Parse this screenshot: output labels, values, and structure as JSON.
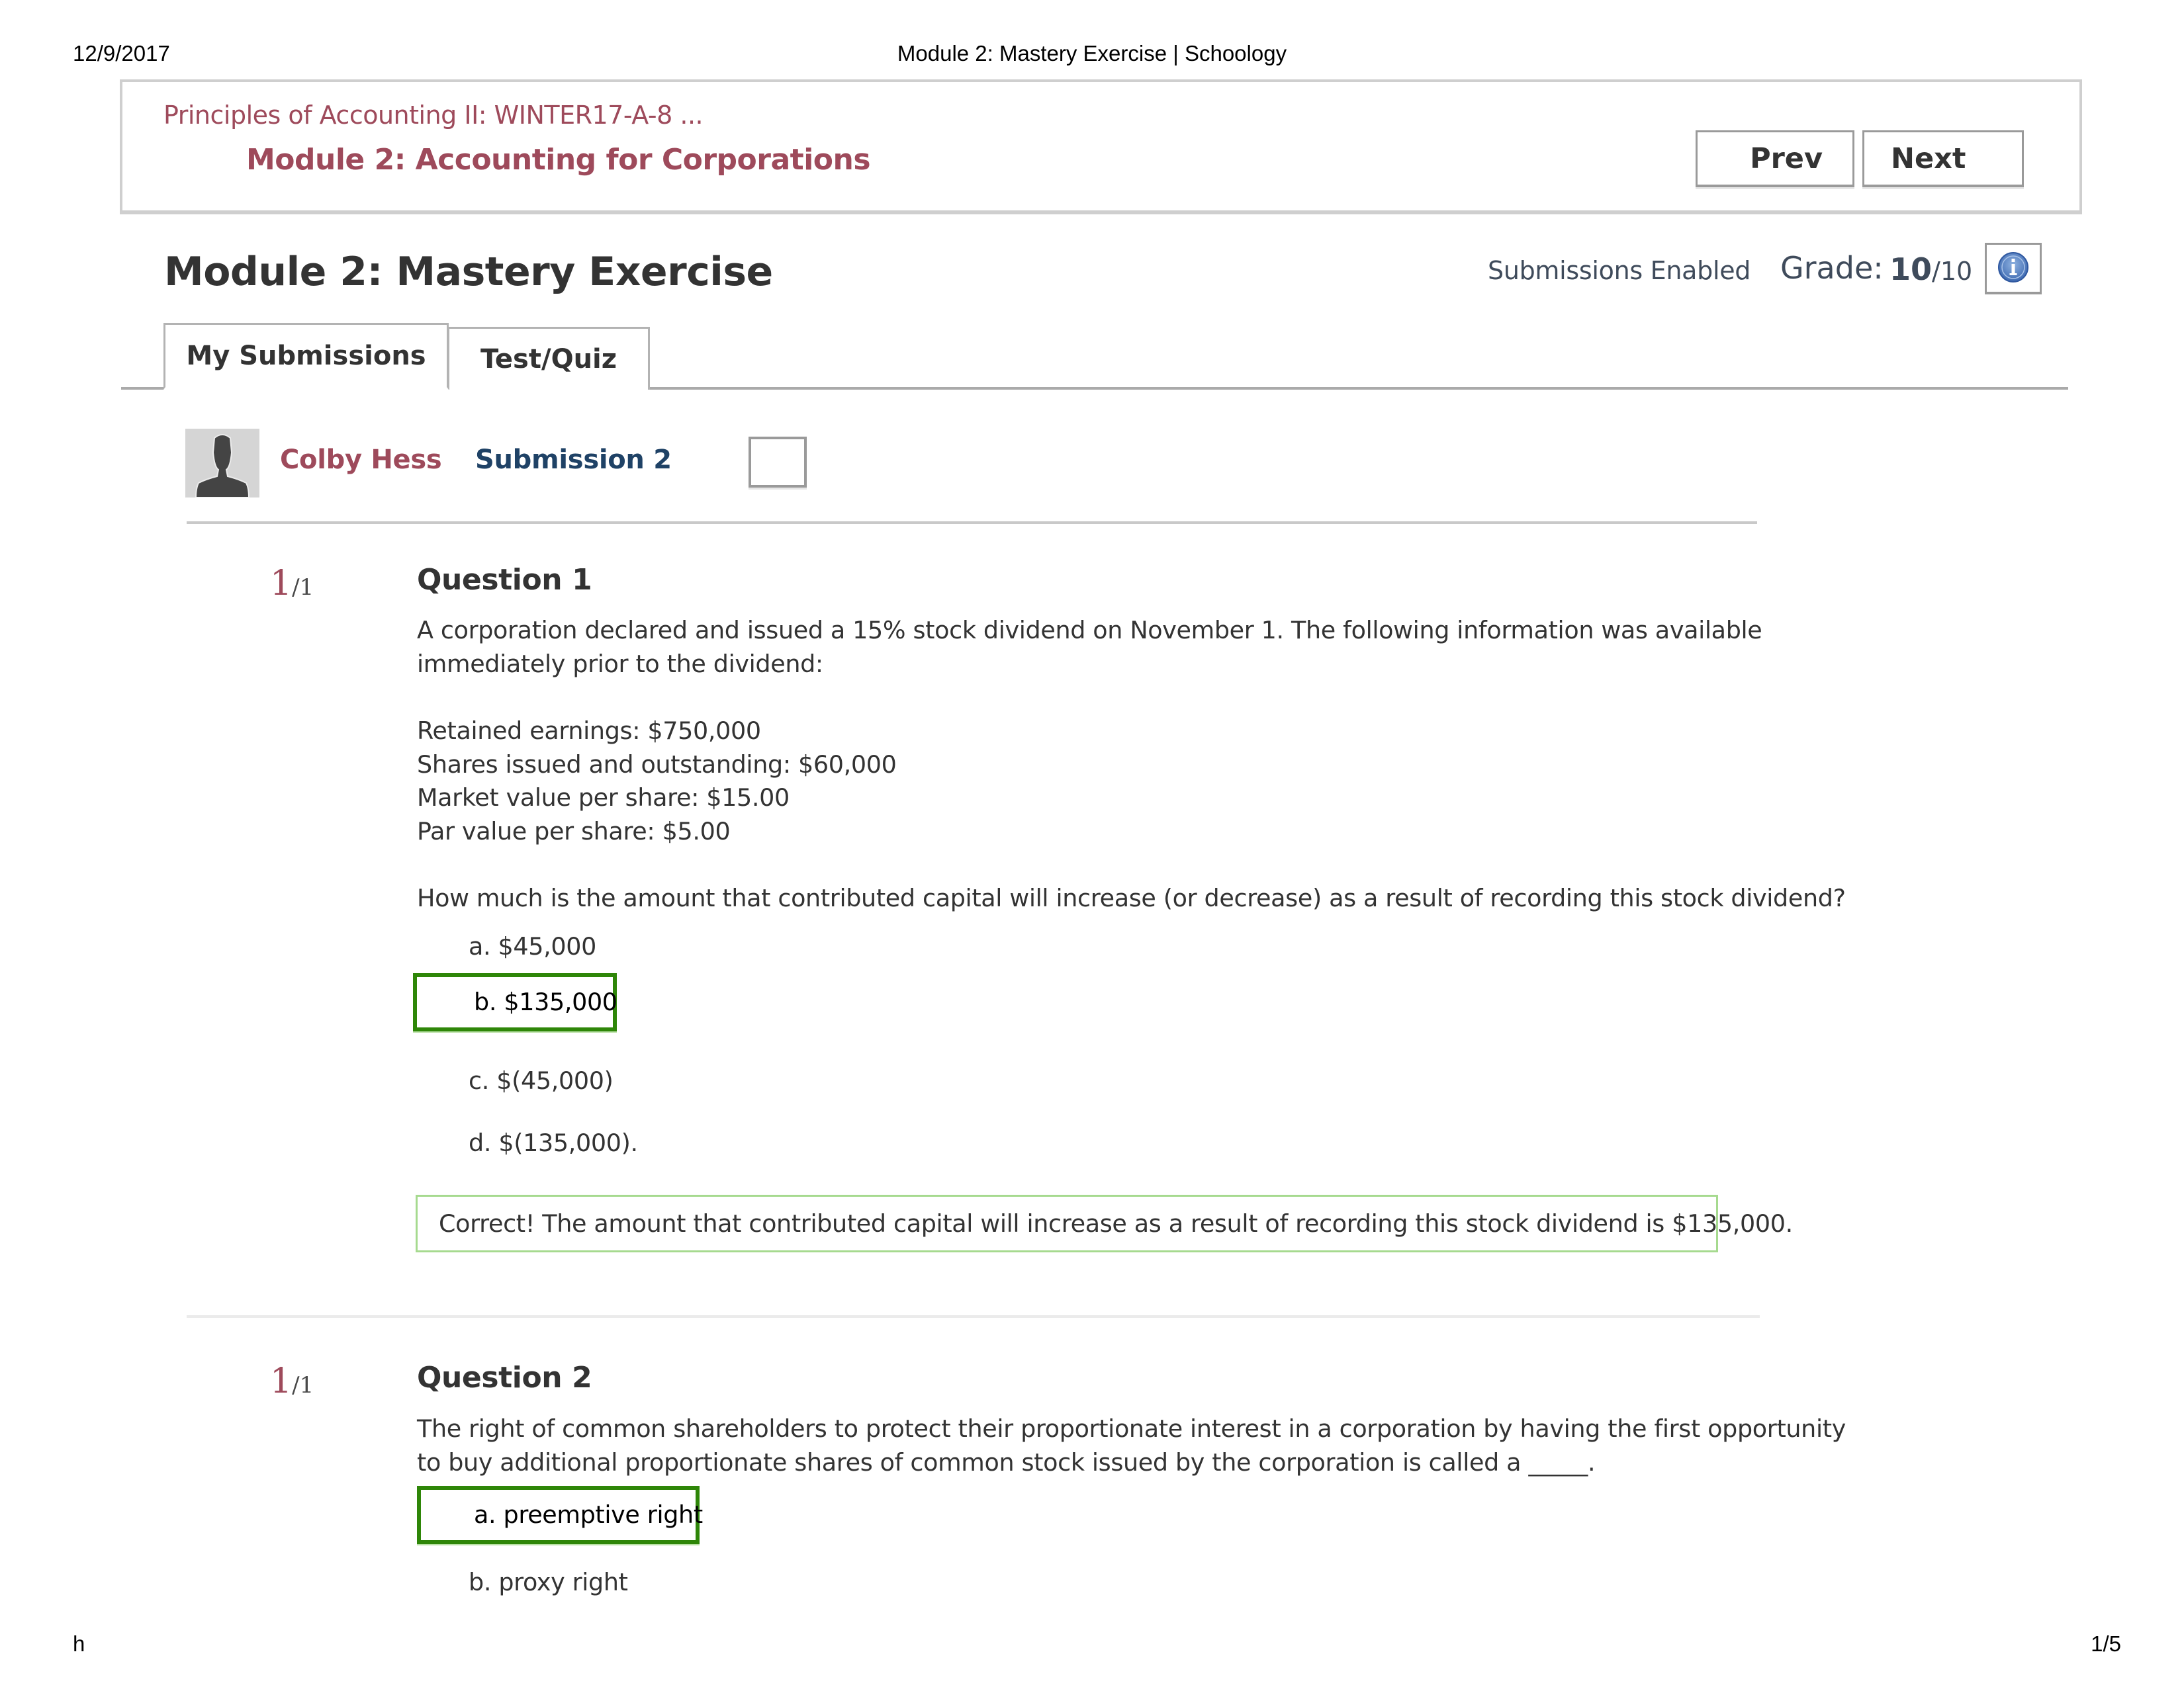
{
  "print_header": {
    "date": "12/9/2017",
    "title": "Module 2: Mastery Exercise | Schoology"
  },
  "print_footer": {
    "left": "h",
    "page": "1/5"
  },
  "course_header": {
    "breadcrumb": "Principles of Accounting II: WINTER17-A-8 ...",
    "module_title": "Module 2: Accounting for Corporations",
    "prev_label": "Prev",
    "next_label": "Next"
  },
  "assignment": {
    "title": "Module 2: Mastery Exercise",
    "status": "Submissions Enabled",
    "grade_label": "Grade:",
    "grade_score": "10",
    "grade_total": "/10",
    "info_icon": "info-icon"
  },
  "tabs": [
    {
      "label": "My Submissions",
      "active": true
    },
    {
      "label": "Test/Quiz",
      "active": false
    }
  ],
  "submission": {
    "user_name": "Colby Hess",
    "submission_label": "Submission 2",
    "avatar_icon": "user-silhouette-icon"
  },
  "questions": [
    {
      "score": "1",
      "score_total": "/1",
      "title": "Question 1",
      "text_lines": [
        "A corporation declared and issued a 15% stock dividend on November 1. The following information was available",
        "immediately prior to the dividend:"
      ],
      "info_lines": [
        "Retained earnings: $750,000",
        "Shares issued and outstanding: $60,000",
        "Market value per share: $15.00",
        "Par value per share: $5.00"
      ],
      "prompt": "How much is the amount that contributed capital will increase (or decrease) as a result of recording this stock dividend?",
      "choices": [
        {
          "label": "a. $45,000",
          "selected": false
        },
        {
          "label": "b. $135,000",
          "selected": true
        },
        {
          "label": "c. $(45,000)",
          "selected": false
        },
        {
          "label": "d. $(135,000).",
          "selected": false
        }
      ],
      "feedback": "Correct! The amount that contributed capital will increase as a result of recording this stock dividend is $135,000."
    },
    {
      "score": "1",
      "score_total": "/1",
      "title": "Question 2",
      "text_lines": [
        "The right of common shareholders to protect their proportionate interest in a corporation by having the first opportunity",
        "to buy additional proportionate shares of common stock issued by the corporation is called a _____."
      ],
      "choices": [
        {
          "label": "a. preemptive right",
          "selected": true
        },
        {
          "label": "b. proxy right",
          "selected": false
        }
      ]
    }
  ],
  "colors": {
    "brand_maroon": "#9e4a5b",
    "submission_blue": "#1f4266",
    "correct_green": "#2e8608",
    "feedback_green": "#a6da8f",
    "grade_text": "#3f4b5b"
  }
}
